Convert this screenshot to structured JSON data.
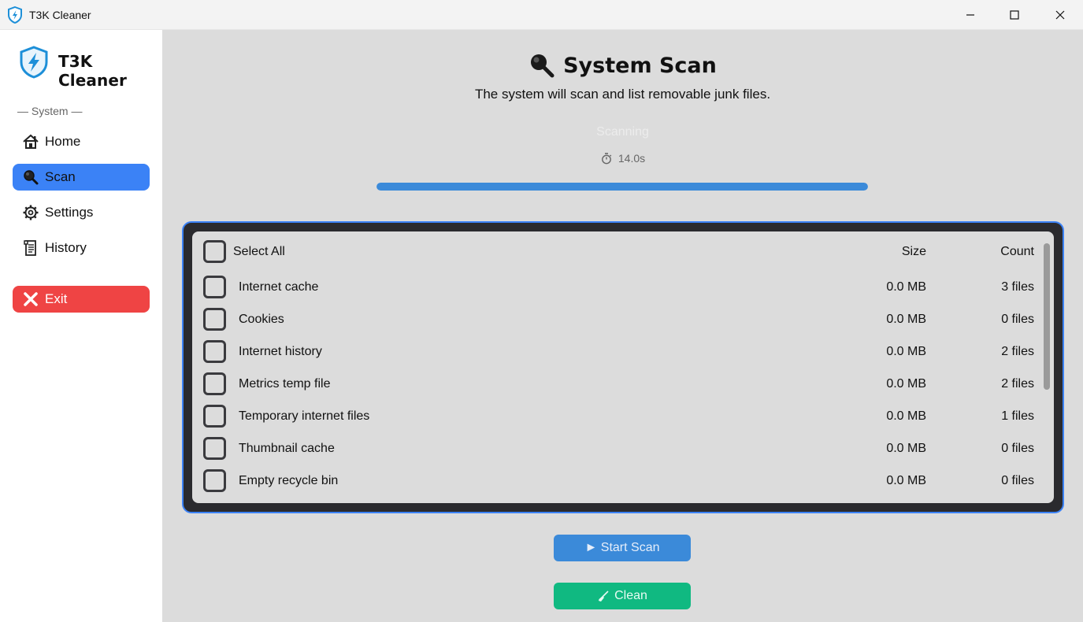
{
  "window": {
    "title": "T3K Cleaner"
  },
  "sidebar": {
    "brand": "T3K Cleaner",
    "section_label": "— System —",
    "items": [
      {
        "label": "Home",
        "icon": "home-icon"
      },
      {
        "label": "Scan",
        "icon": "magnifier-icon",
        "active": true
      },
      {
        "label": "Settings",
        "icon": "gear-icon"
      },
      {
        "label": "History",
        "icon": "scroll-icon"
      }
    ],
    "exit_label": "Exit"
  },
  "main": {
    "title": "System Scan",
    "subtitle": "The system will scan and list removable junk files.",
    "status": "Scanning",
    "elapsed": "14.0s",
    "progress": 1.0,
    "list": {
      "header": {
        "select_all": "Select All",
        "size": "Size",
        "count": "Count"
      },
      "rows": [
        {
          "name": "Internet cache",
          "size": "0.0 MB",
          "count": "3 files"
        },
        {
          "name": "Cookies",
          "size": "0.0 MB",
          "count": "0 files"
        },
        {
          "name": "Internet history",
          "size": "0.0 MB",
          "count": "2 files"
        },
        {
          "name": "Metrics temp file",
          "size": "0.0 MB",
          "count": "2 files"
        },
        {
          "name": "Temporary internet files",
          "size": "0.0 MB",
          "count": "1 files"
        },
        {
          "name": "Thumbnail cache",
          "size": "0.0 MB",
          "count": "0 files"
        },
        {
          "name": "Empty recycle bin",
          "size": "0.0 MB",
          "count": "0 files"
        }
      ]
    },
    "start_scan_label": "► Start Scan",
    "clean_label": "Clean"
  },
  "colors": {
    "accent": "#3b82f6",
    "exit": "#ef4444",
    "progress": "#3b8ad9",
    "clean": "#10b981",
    "panel": "#2a2a2e"
  }
}
